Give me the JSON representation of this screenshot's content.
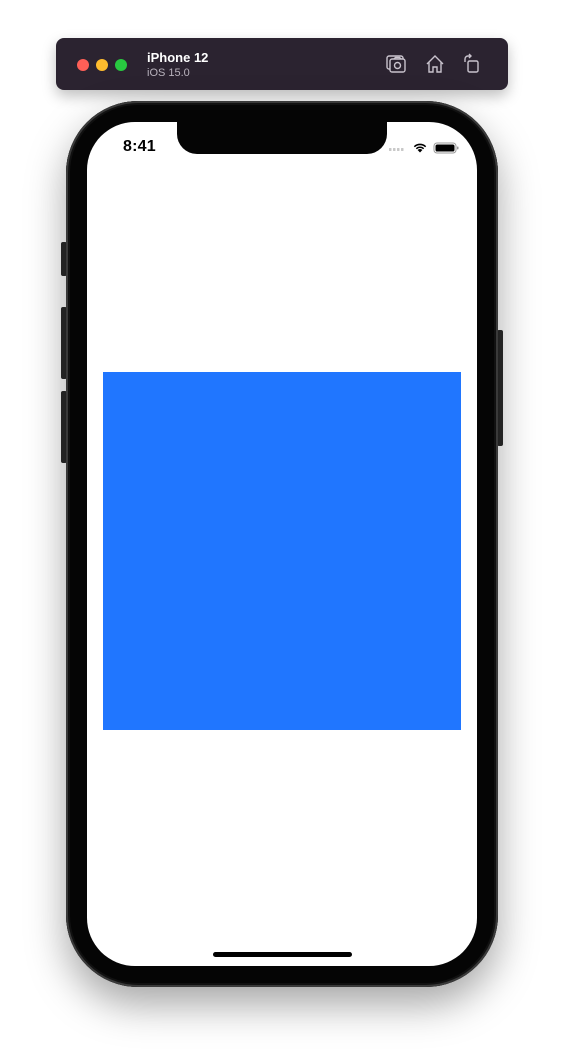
{
  "simulator": {
    "device_name": "iPhone 12",
    "os_version": "iOS 15.0",
    "toolbar_icons": [
      "screenshot-icon",
      "home-icon",
      "rotate-icon"
    ]
  },
  "status_bar": {
    "time": "8:41",
    "icons": [
      "cellular-signal-icon",
      "wifi-icon",
      "battery-icon"
    ]
  },
  "content": {
    "square_color": "#2076FF"
  },
  "colors": {
    "titlebar": "#2B2330",
    "traffic_red": "#FE5F57",
    "traffic_yellow": "#FEBC2E",
    "traffic_green": "#28C840"
  }
}
